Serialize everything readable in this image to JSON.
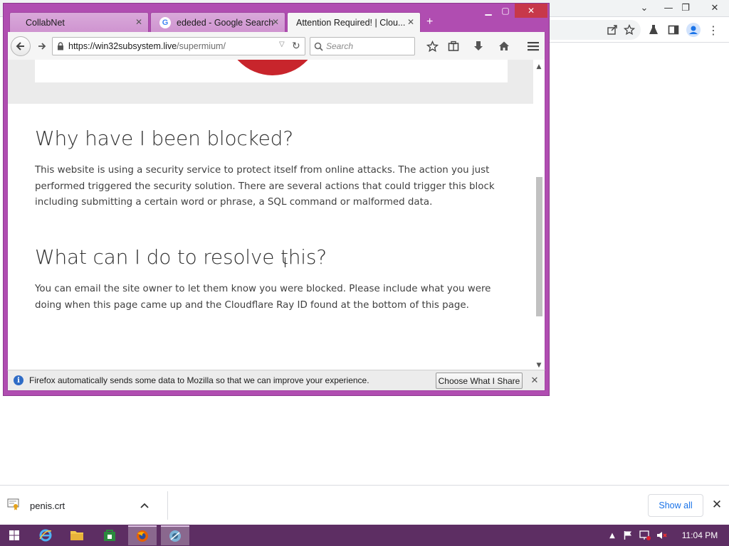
{
  "firefox": {
    "tabs": [
      {
        "title": "CollabNet"
      },
      {
        "title": "ededed - Google Search"
      },
      {
        "title": "Attention Required! | Clou..."
      }
    ],
    "new_tab_label": "+",
    "url": {
      "host": "https://win32subsystem.live",
      "path": "/supermium/"
    },
    "search_placeholder": "Search",
    "page": {
      "heading1": "Why have I been blocked?",
      "para1": "This website is using a security service to protect itself from online attacks. The action you just performed triggered the security solution. There are several actions that could trigger this block including submitting a certain word or phrase, a SQL command or malformed data.",
      "heading2": "What can I do to resolve this?",
      "para2": "You can email the site owner to let them know you were blocked. Please include what you were doing when this page came up and the Cloudflare Ray ID found at the bottom of this page."
    },
    "notification": {
      "text": "Firefox automatically sends some data to Mozilla so that we can improve your experience.",
      "button": "Choose What I Share"
    }
  },
  "downloads": {
    "item_name": "penis.crt",
    "show_all": "Show all"
  },
  "taskbar": {
    "clock": "11:04 PM"
  },
  "colors": {
    "firefox_frame": "#b04db1",
    "taskbar": "#5d2e63",
    "cloudflare_red": "#c8252c",
    "chrome_link_blue": "#1a73e8"
  }
}
